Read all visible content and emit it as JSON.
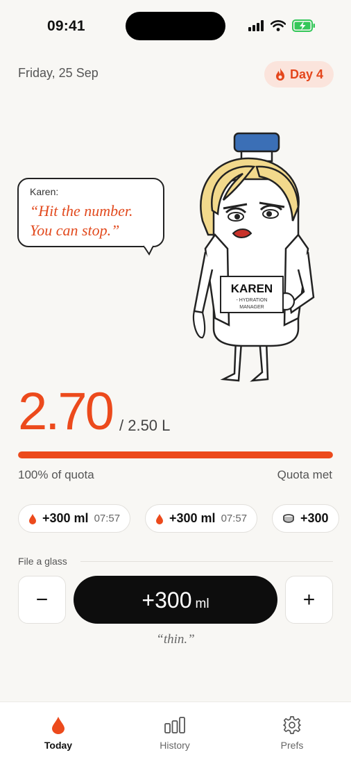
{
  "status_bar": {
    "time": "09:41"
  },
  "header": {
    "date": "Friday, 25 Sep",
    "streak_label": "Day 4"
  },
  "speech": {
    "speaker": "Karen:",
    "quote_line1": "“Hit the number.",
    "quote_line2": "You can stop.”"
  },
  "mascot": {
    "label_title": "KAREN",
    "label_line1": "- HYDRATION",
    "label_line2": "MANAGER"
  },
  "intake": {
    "amount": "2.70",
    "goal": "/ 2.50 L",
    "progress_fraction": 1.0,
    "percent_label": "100% of quota",
    "status_label": "Quota met"
  },
  "log": [
    {
      "amount": "+300 ml",
      "time": "07:57",
      "icon": "drop-icon"
    },
    {
      "amount": "+300 ml",
      "time": "07:57",
      "icon": "drop-icon"
    },
    {
      "amount": "+300",
      "time": "",
      "icon": "cup-icon"
    }
  ],
  "quick_add": {
    "section_label": "File a glass",
    "minus": "−",
    "plus": "+",
    "value": "+300",
    "unit": "ml",
    "remark": "“thin.”"
  },
  "tabs": [
    {
      "label": "Today",
      "icon": "drop-icon",
      "active": true
    },
    {
      "label": "History",
      "icon": "bar-chart-icon",
      "active": false
    },
    {
      "label": "Prefs",
      "icon": "gear-icon",
      "active": false
    }
  ],
  "colors": {
    "accent": "#ec4a1c",
    "badge_bg": "#fbe4dc",
    "background": "#f8f7f4",
    "primary_button": "#0d0d0d"
  }
}
